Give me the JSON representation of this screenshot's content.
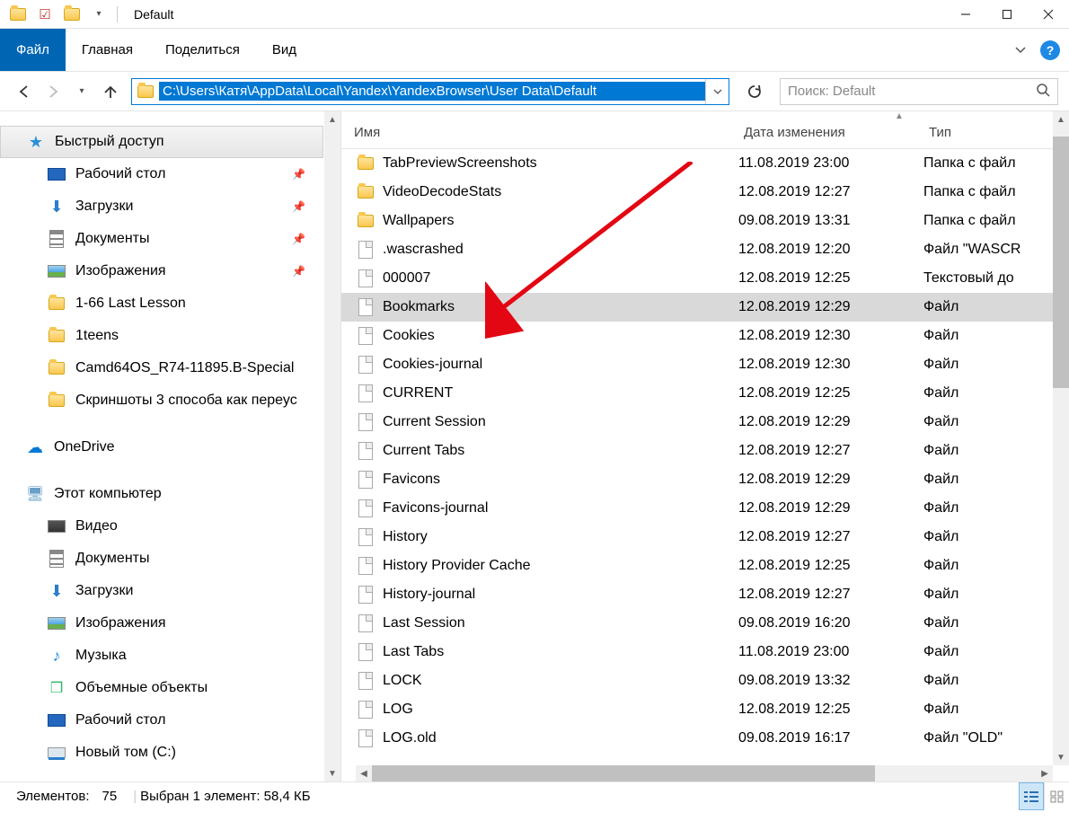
{
  "title": "Default",
  "ribbon": {
    "file": "Файл",
    "tabs": [
      "Главная",
      "Поделиться",
      "Вид"
    ]
  },
  "address_path": "C:\\Users\\Катя\\AppData\\Local\\Yandex\\YandexBrowser\\User Data\\Default",
  "search_placeholder": "Поиск: Default",
  "sidebar": {
    "quick_access": "Быстрый доступ",
    "quick_items": [
      {
        "label": "Рабочий стол",
        "icon": "desktop",
        "pinned": true
      },
      {
        "label": "Загрузки",
        "icon": "download",
        "pinned": true
      },
      {
        "label": "Документы",
        "icon": "doc",
        "pinned": true
      },
      {
        "label": "Изображения",
        "icon": "img",
        "pinned": true
      },
      {
        "label": "1-66 Last Lesson",
        "icon": "folder",
        "pinned": false
      },
      {
        "label": "1teens",
        "icon": "folder",
        "pinned": false
      },
      {
        "label": "Camd64OS_R74-11895.B-Special",
        "icon": "folder",
        "pinned": false
      },
      {
        "label": "Скриншоты 3 способа как переус",
        "icon": "folder",
        "pinned": false
      }
    ],
    "onedrive": "OneDrive",
    "this_pc": "Этот компьютер",
    "pc_items": [
      {
        "label": "Видео",
        "icon": "video"
      },
      {
        "label": "Документы",
        "icon": "doc"
      },
      {
        "label": "Загрузки",
        "icon": "download"
      },
      {
        "label": "Изображения",
        "icon": "img"
      },
      {
        "label": "Музыка",
        "icon": "music"
      },
      {
        "label": "Объемные объекты",
        "icon": "cube"
      },
      {
        "label": "Рабочий стол",
        "icon": "desktop"
      },
      {
        "label": "Новый том (C:)",
        "icon": "drive"
      }
    ]
  },
  "columns": {
    "name": "Имя",
    "date": "Дата изменения",
    "type": "Тип"
  },
  "files": [
    {
      "name": "TabPreviewScreenshots",
      "date": "11.08.2019 23:00",
      "type": "Папка с файл",
      "icon": "folder"
    },
    {
      "name": "VideoDecodeStats",
      "date": "12.08.2019 12:27",
      "type": "Папка с файл",
      "icon": "folder"
    },
    {
      "name": "Wallpapers",
      "date": "09.08.2019 13:31",
      "type": "Папка с файл",
      "icon": "folder"
    },
    {
      "name": ".wascrashed",
      "date": "12.08.2019 12:20",
      "type": "Файл \"WASCR",
      "icon": "file"
    },
    {
      "name": "000007",
      "date": "12.08.2019 12:25",
      "type": "Текстовый до",
      "icon": "file"
    },
    {
      "name": "Bookmarks",
      "date": "12.08.2019 12:29",
      "type": "Файл",
      "icon": "file",
      "selected": true
    },
    {
      "name": "Cookies",
      "date": "12.08.2019 12:30",
      "type": "Файл",
      "icon": "file"
    },
    {
      "name": "Cookies-journal",
      "date": "12.08.2019 12:30",
      "type": "Файл",
      "icon": "file"
    },
    {
      "name": "CURRENT",
      "date": "12.08.2019 12:25",
      "type": "Файл",
      "icon": "file"
    },
    {
      "name": "Current Session",
      "date": "12.08.2019 12:29",
      "type": "Файл",
      "icon": "file"
    },
    {
      "name": "Current Tabs",
      "date": "12.08.2019 12:27",
      "type": "Файл",
      "icon": "file"
    },
    {
      "name": "Favicons",
      "date": "12.08.2019 12:29",
      "type": "Файл",
      "icon": "file"
    },
    {
      "name": "Favicons-journal",
      "date": "12.08.2019 12:29",
      "type": "Файл",
      "icon": "file"
    },
    {
      "name": "History",
      "date": "12.08.2019 12:27",
      "type": "Файл",
      "icon": "file"
    },
    {
      "name": "History Provider Cache",
      "date": "12.08.2019 12:25",
      "type": "Файл",
      "icon": "file"
    },
    {
      "name": "History-journal",
      "date": "12.08.2019 12:27",
      "type": "Файл",
      "icon": "file"
    },
    {
      "name": "Last Session",
      "date": "09.08.2019 16:20",
      "type": "Файл",
      "icon": "file"
    },
    {
      "name": "Last Tabs",
      "date": "11.08.2019 23:00",
      "type": "Файл",
      "icon": "file"
    },
    {
      "name": "LOCK",
      "date": "09.08.2019 13:32",
      "type": "Файл",
      "icon": "file"
    },
    {
      "name": "LOG",
      "date": "12.08.2019 12:25",
      "type": "Файл",
      "icon": "file"
    },
    {
      "name": "LOG.old",
      "date": "09.08.2019 16:17",
      "type": "Файл \"OLD\"",
      "icon": "file"
    }
  ],
  "status": {
    "elements_label": "Элементов:",
    "elements_count": "75",
    "selection": "Выбран 1 элемент: 58,4 КБ"
  }
}
